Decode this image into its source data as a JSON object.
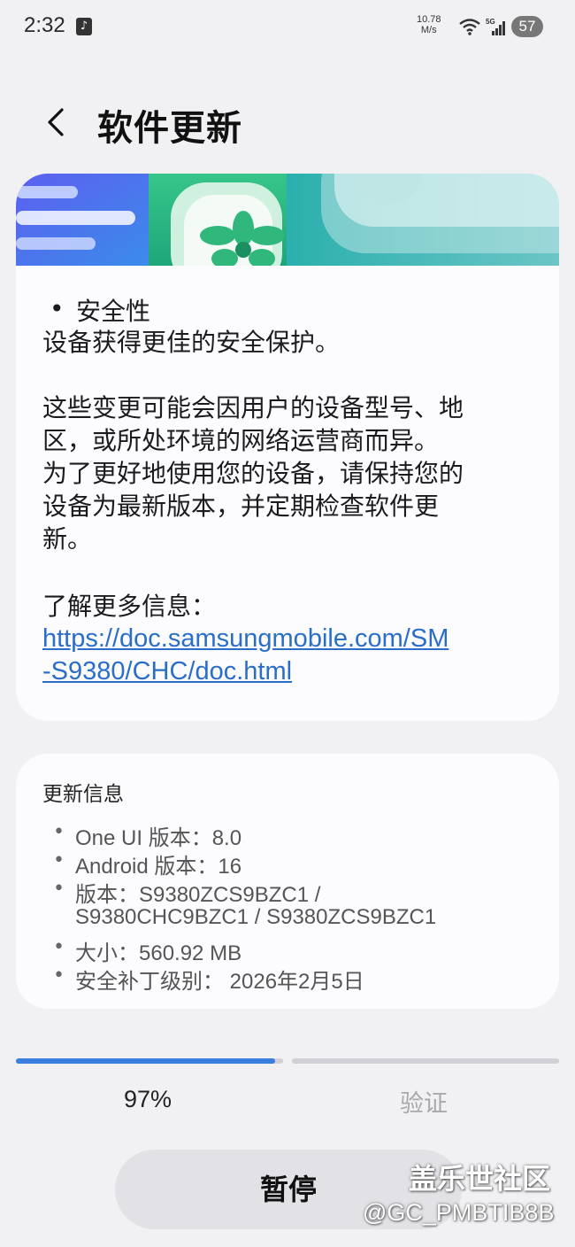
{
  "status_bar": {
    "time": "2:32",
    "net_speed_value": "10.78",
    "net_speed_unit": "M/s",
    "battery": "57",
    "icons": [
      "tiktok-icon",
      "wifi-icon",
      "signal-5g-icon",
      "battery-icon"
    ]
  },
  "header": {
    "title": "软件更新",
    "back_icon": "chevron-left-icon"
  },
  "release_notes": {
    "bullet": "•",
    "security_title": "安全性",
    "security_desc": "设备获得更佳的安全保护。",
    "notice_lines": [
      "这些变更可能会因用户的设备型号、地",
      "区，或所处环境的网络运营商而异。",
      "为了更好地使用您的设备，请保持您的",
      "设备为最新版本，并定期检查软件更",
      "新。"
    ],
    "more_info": "了解更多信息：",
    "link_lines": [
      "https://doc.samsungmobile.com/SM",
      "-S9380/CHC/doc.html"
    ]
  },
  "update_info": {
    "title": "更新信息",
    "bullet": "•",
    "one_ui": "One UI 版本：8.0",
    "android": "Android 版本：16",
    "version_line1": "版本：S9380ZCS9BZC1 /",
    "version_line2": "S9380CHC9BZC1 / S9380ZCS9BZC1",
    "size": "大小：560.92 MB",
    "security_patch": "安全补丁级别： 2026年2月5日"
  },
  "progress": {
    "percent_label": "97%",
    "download_fraction": 0.97,
    "next_step": "验证",
    "active_color": "#3a7fe0",
    "track_color": "#d0d0d6"
  },
  "actions": {
    "pause_label": "暂停"
  },
  "watermark": {
    "line1": "盖乐世社区",
    "line2": "@GC_PMBTIB8B"
  },
  "colors": {
    "background": "#f1f1f4",
    "card": "#fcfcfe",
    "link": "#2a6ec8"
  }
}
